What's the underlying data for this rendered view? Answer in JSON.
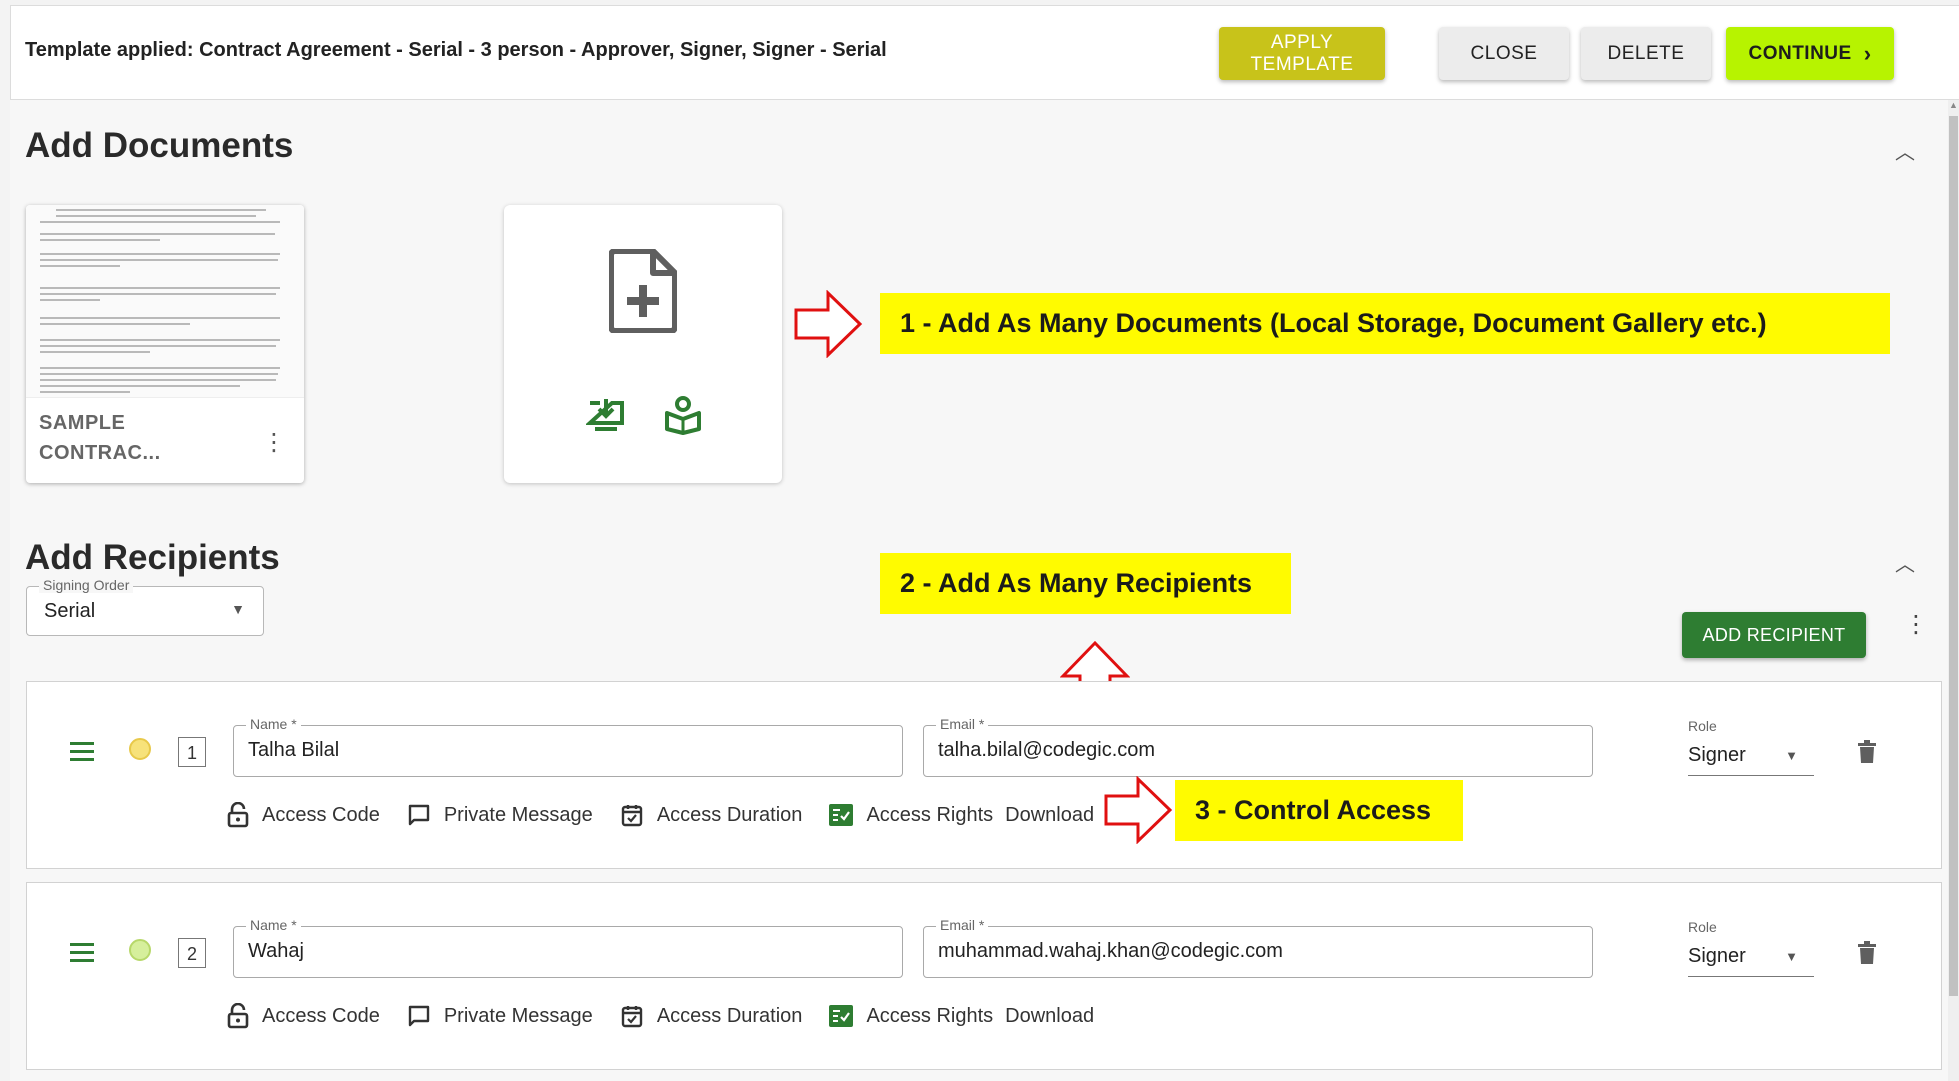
{
  "header": {
    "template_text": "Template applied: Contract Agreement - Serial - 3 person - Approver, Signer, Signer - Serial",
    "buttons": {
      "apply": "APPLY TEMPLATE",
      "close": "CLOSE",
      "delete": "DELETE",
      "continue": "CONTINUE",
      "continue_icon": "chevron-right-icon"
    },
    "colors": {
      "apply": "#c8c31a",
      "continue": "#b7f300"
    }
  },
  "documents": {
    "title": "Add Documents",
    "items": [
      {
        "name_line1": "SAMPLE",
        "name_line2": "CONTRAC..."
      }
    ],
    "add_card_icons": [
      "file-add-icon",
      "download-to-device-icon",
      "document-gallery-icon"
    ]
  },
  "annotations": {
    "one": "1 - Add As Many Documents (Local Storage, Document Gallery etc.)",
    "two": "2 - Add As Many Recipients",
    "three": "3 - Control Access",
    "color": "#fffb00"
  },
  "recipients_section": {
    "title": "Add Recipients",
    "signing_order_label": "Signing Order",
    "signing_order_value": "Serial",
    "add_button": "ADD RECIPIENT",
    "add_button_color": "#2e7d32"
  },
  "recipients": [
    {
      "order": "1",
      "name_label": "Name *",
      "name": "Talha Bilal",
      "email_label": "Email *",
      "email": "talha.bilal@codegic.com",
      "role_label": "Role",
      "role": "Signer",
      "status_color": "#f7e27a"
    },
    {
      "order": "2",
      "name_label": "Name *",
      "name": "Wahaj",
      "email_label": "Email *",
      "email": "muhammad.wahaj.khan@codegic.com",
      "role_label": "Role",
      "role": "Signer",
      "status_color": "#d6ef9c"
    }
  ],
  "access_options": {
    "access_code": "Access Code",
    "private_message": "Private Message",
    "access_duration": "Access Duration",
    "access_rights": "Access Rights",
    "download": "Download"
  }
}
